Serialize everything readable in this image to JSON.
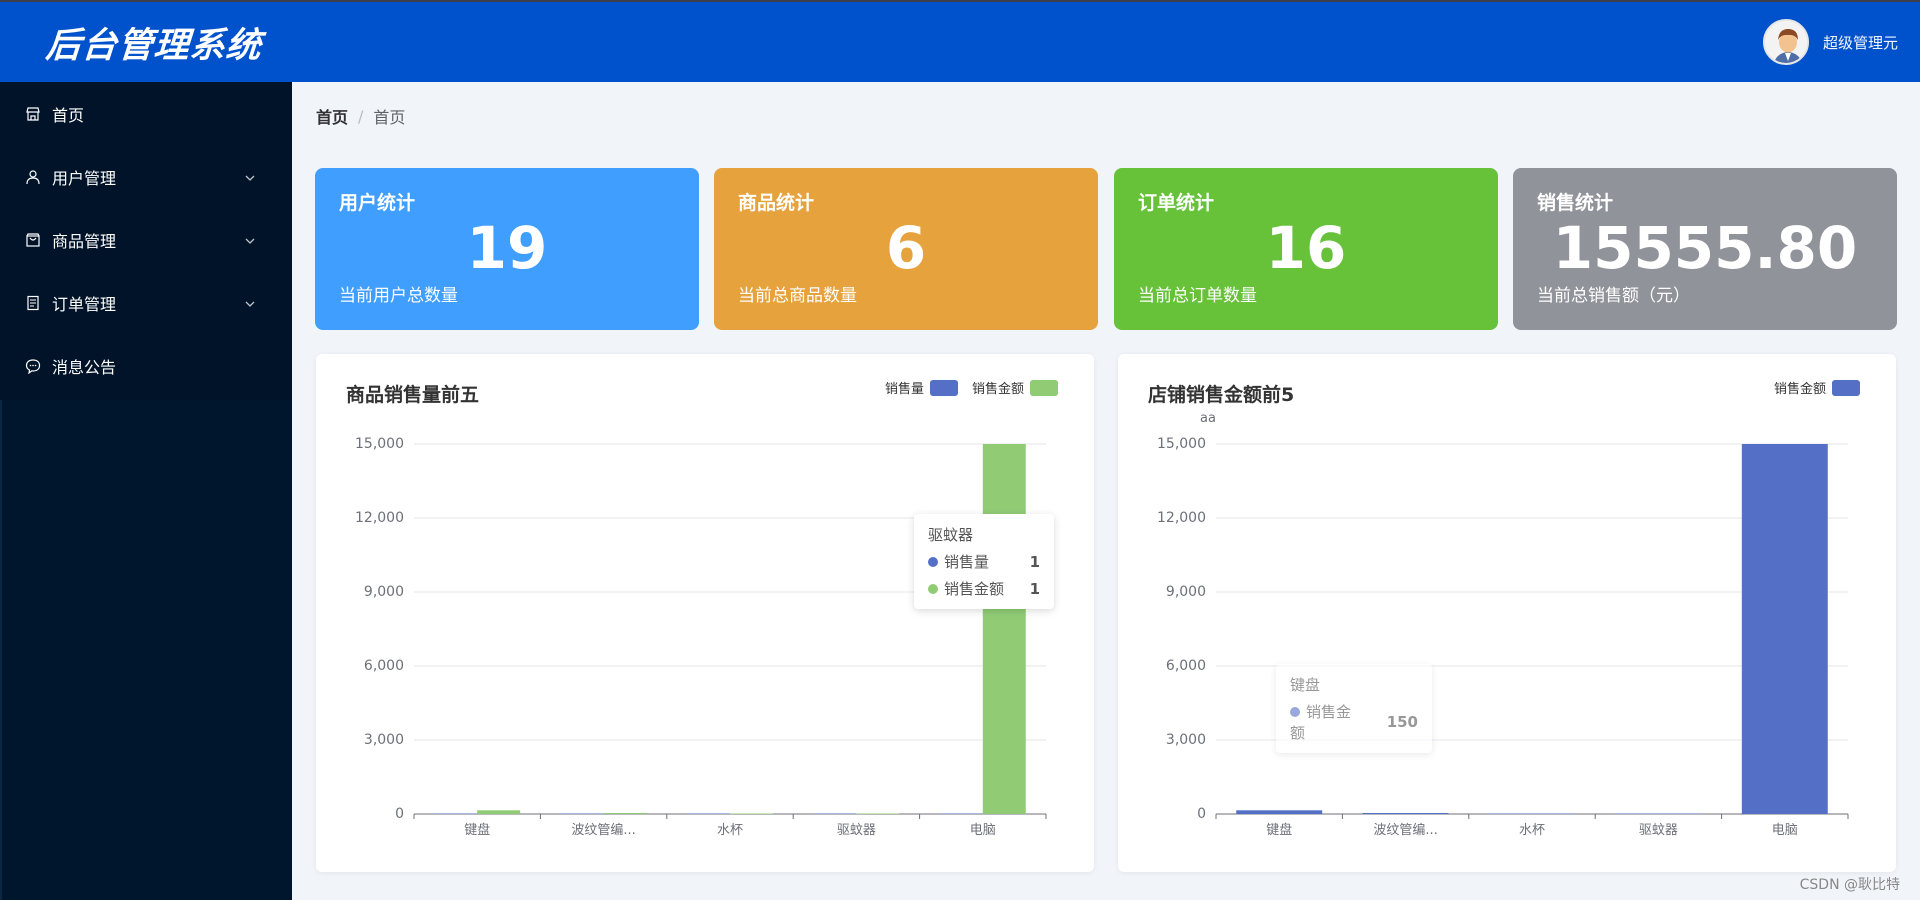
{
  "header": {
    "title": "后台管理系统",
    "user_name": "超级管理元"
  },
  "sidebar": {
    "items": [
      {
        "label": "首页",
        "icon": "store-icon",
        "has_arrow": false
      },
      {
        "label": "用户管理",
        "icon": "user-icon",
        "has_arrow": true
      },
      {
        "label": "商品管理",
        "icon": "bag-icon",
        "has_arrow": true
      },
      {
        "label": "订单管理",
        "icon": "document-icon",
        "has_arrow": true
      },
      {
        "label": "消息公告",
        "icon": "chat-icon",
        "has_arrow": false
      }
    ]
  },
  "breadcrumb": {
    "first": "首页",
    "separator": "/",
    "current": "首页"
  },
  "cards": [
    {
      "title": "用户统计",
      "value": "19",
      "sub": "当前用户总数量",
      "color": "#409eff"
    },
    {
      "title": "商品统计",
      "value": "6",
      "sub": "当前总商品数量",
      "color": "#e6a23c"
    },
    {
      "title": "订单统计",
      "value": "16",
      "sub": "当前总订单数量",
      "color": "#67c23a"
    },
    {
      "title": "销售统计",
      "value": "15555.80",
      "sub": "当前总销售额（元）",
      "color": "#909399"
    }
  ],
  "chart_data": [
    {
      "type": "bar",
      "title": "商品销售量前五",
      "categories": [
        "键盘",
        "波纹管编...",
        "水杯",
        "驱蚊器",
        "电脑"
      ],
      "series": [
        {
          "name": "销售量",
          "color": "#5470c6",
          "values": [
            1,
            1,
            1,
            1,
            1
          ]
        },
        {
          "name": "销售金额",
          "color": "#91cc75",
          "values": [
            150,
            40,
            20,
            1,
            15000
          ]
        }
      ],
      "yticks": [
        "0",
        "3,000",
        "6,000",
        "9,000",
        "12,000",
        "15,000"
      ],
      "ylim": [
        0,
        15000
      ],
      "tooltip": {
        "title": "驱蚊器",
        "rows": [
          {
            "name": "销售量",
            "value": "1"
          },
          {
            "name": "销售金额",
            "value": "1"
          }
        ]
      }
    },
    {
      "type": "bar",
      "title": "店铺销售金额前5",
      "ylabel": "aa",
      "categories": [
        "键盘",
        "波纹管编...",
        "水杯",
        "驱蚊器",
        "电脑"
      ],
      "series": [
        {
          "name": "销售金额",
          "color": "#5470c6",
          "values": [
            150,
            40,
            20,
            1,
            15000
          ]
        }
      ],
      "yticks": [
        "0",
        "3,000",
        "6,000",
        "9,000",
        "12,000",
        "15,000"
      ],
      "ylim": [
        0,
        15000
      ],
      "tooltip": {
        "title": "键盘",
        "rows": [
          {
            "name": "销售金额",
            "value": "150"
          }
        ]
      }
    }
  ],
  "watermark": "CSDN @耿比特"
}
